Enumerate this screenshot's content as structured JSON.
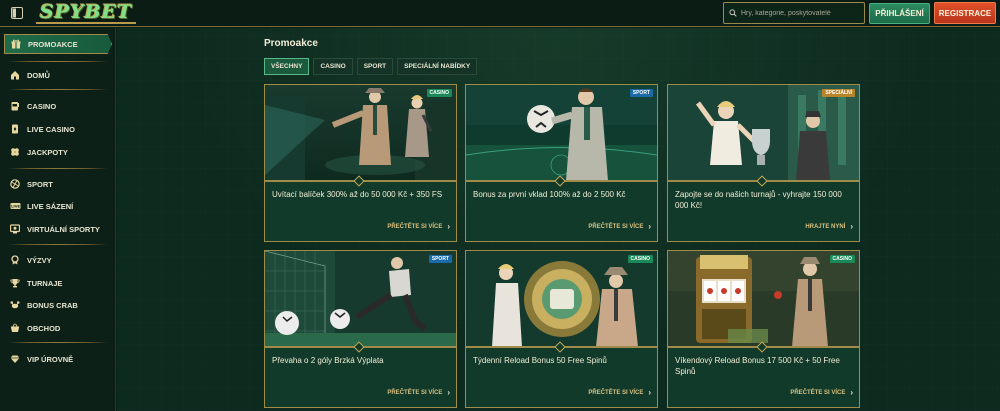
{
  "header": {
    "logo": "SPYBET",
    "search_placeholder": "Hry, kategorie, poskytovatelé",
    "login_label": "PŘIHLÁŠENÍ",
    "register_label": "REGISTRACE"
  },
  "sidebar": {
    "items": [
      {
        "label": "PROMOAKCE",
        "icon": "gift-icon"
      },
      {
        "label": "DOMŮ",
        "icon": "home-icon"
      },
      {
        "label": "CASINO",
        "icon": "slot-icon"
      },
      {
        "label": "LIVE CASINO",
        "icon": "card-icon"
      },
      {
        "label": "JACKPOTY",
        "icon": "clover-icon"
      },
      {
        "label": "SPORT",
        "icon": "ball-icon"
      },
      {
        "label": "LIVE SÁZENÍ",
        "icon": "live-icon"
      },
      {
        "label": "VIRTUÁLNÍ SPORTY",
        "icon": "virtual-icon"
      },
      {
        "label": "VÝZVY",
        "icon": "medal-icon"
      },
      {
        "label": "TURNAJE",
        "icon": "trophy-icon"
      },
      {
        "label": "BONUS CRAB",
        "icon": "crab-icon"
      },
      {
        "label": "OBCHOD",
        "icon": "basket-icon"
      },
      {
        "label": "VIP ÚROVNĚ",
        "icon": "diamond-icon"
      }
    ]
  },
  "main": {
    "title": "Promoakce",
    "tabs": [
      "VŠECHNY",
      "CASINO",
      "SPORT",
      "SPECIÁLNÍ NABÍDKY"
    ],
    "cards": [
      {
        "badge": "CASINO",
        "title": "Uvítací balíček 300% až do 50 000 Kč + 350 FS",
        "cta": "PŘEČTĚTE SI VÍCE"
      },
      {
        "badge": "SPORT",
        "title": "Bonus za první vklad 100% až do 2 500 Kč",
        "cta": "PŘEČTĚTE SI VÍCE"
      },
      {
        "badge": "SPECIÁLNÍ",
        "title": "Zapojte se do našich turnajů - vyhrajte 150 000 000 Kč!",
        "cta": "HRAJTE NYNÍ"
      },
      {
        "badge": "SPORT",
        "title": "Převaha o 2 góly Brzká Výplata",
        "cta": "PŘEČTĚTE SI VÍCE"
      },
      {
        "badge": "CASINO",
        "title": "Týdenní Reload Bonus 50 Free Spinů",
        "cta": "PŘEČTĚTE SI VÍCE"
      },
      {
        "badge": "CASINO",
        "title": "Víkendový Reload Bonus 17 500 Kč + 50 Free Spinů",
        "cta": "PŘEČTĚTE SI VÍCE"
      }
    ]
  },
  "colors": {
    "accent_gold": "#a08c48",
    "login_green": "#2c8b60",
    "register_orange": "#e0502a"
  }
}
